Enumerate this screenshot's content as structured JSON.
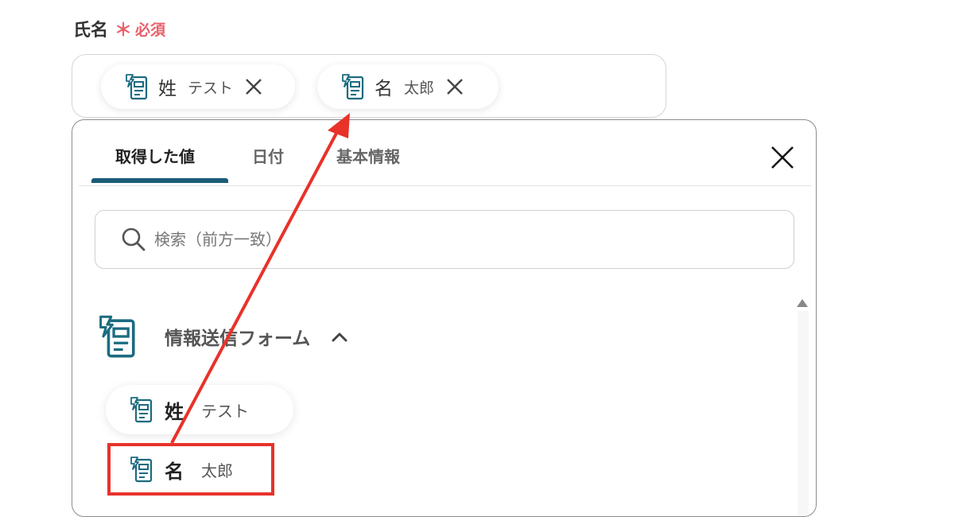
{
  "field": {
    "label": "氏名",
    "required_mark": "＊",
    "required_text": "必須"
  },
  "selected_tags": [
    {
      "key": "姓",
      "value": "テスト",
      "icon": "form-icon",
      "remove_icon": "close-icon"
    },
    {
      "key": "名",
      "value": "太郎",
      "icon": "form-icon",
      "remove_icon": "close-icon"
    }
  ],
  "dropdown": {
    "tabs": [
      {
        "label": "取得した値",
        "active": true
      },
      {
        "label": "日付",
        "active": false
      },
      {
        "label": "基本情報",
        "active": false
      }
    ],
    "close_icon": "close-icon",
    "search": {
      "placeholder": "検索（前方一致）",
      "value": "",
      "icon": "search-icon"
    },
    "group": {
      "title": "情報送信フォーム",
      "expanded": true,
      "icon": "form-icon",
      "toggle_icon": "chevron-up-icon"
    },
    "items": [
      {
        "key": "姓",
        "value": "テスト"
      },
      {
        "key": "名",
        "value": "太郎",
        "highlighted": true
      }
    ]
  },
  "colors": {
    "accent": "#1b5d78",
    "required": "#e8616a",
    "annotation": "#e8322a"
  }
}
